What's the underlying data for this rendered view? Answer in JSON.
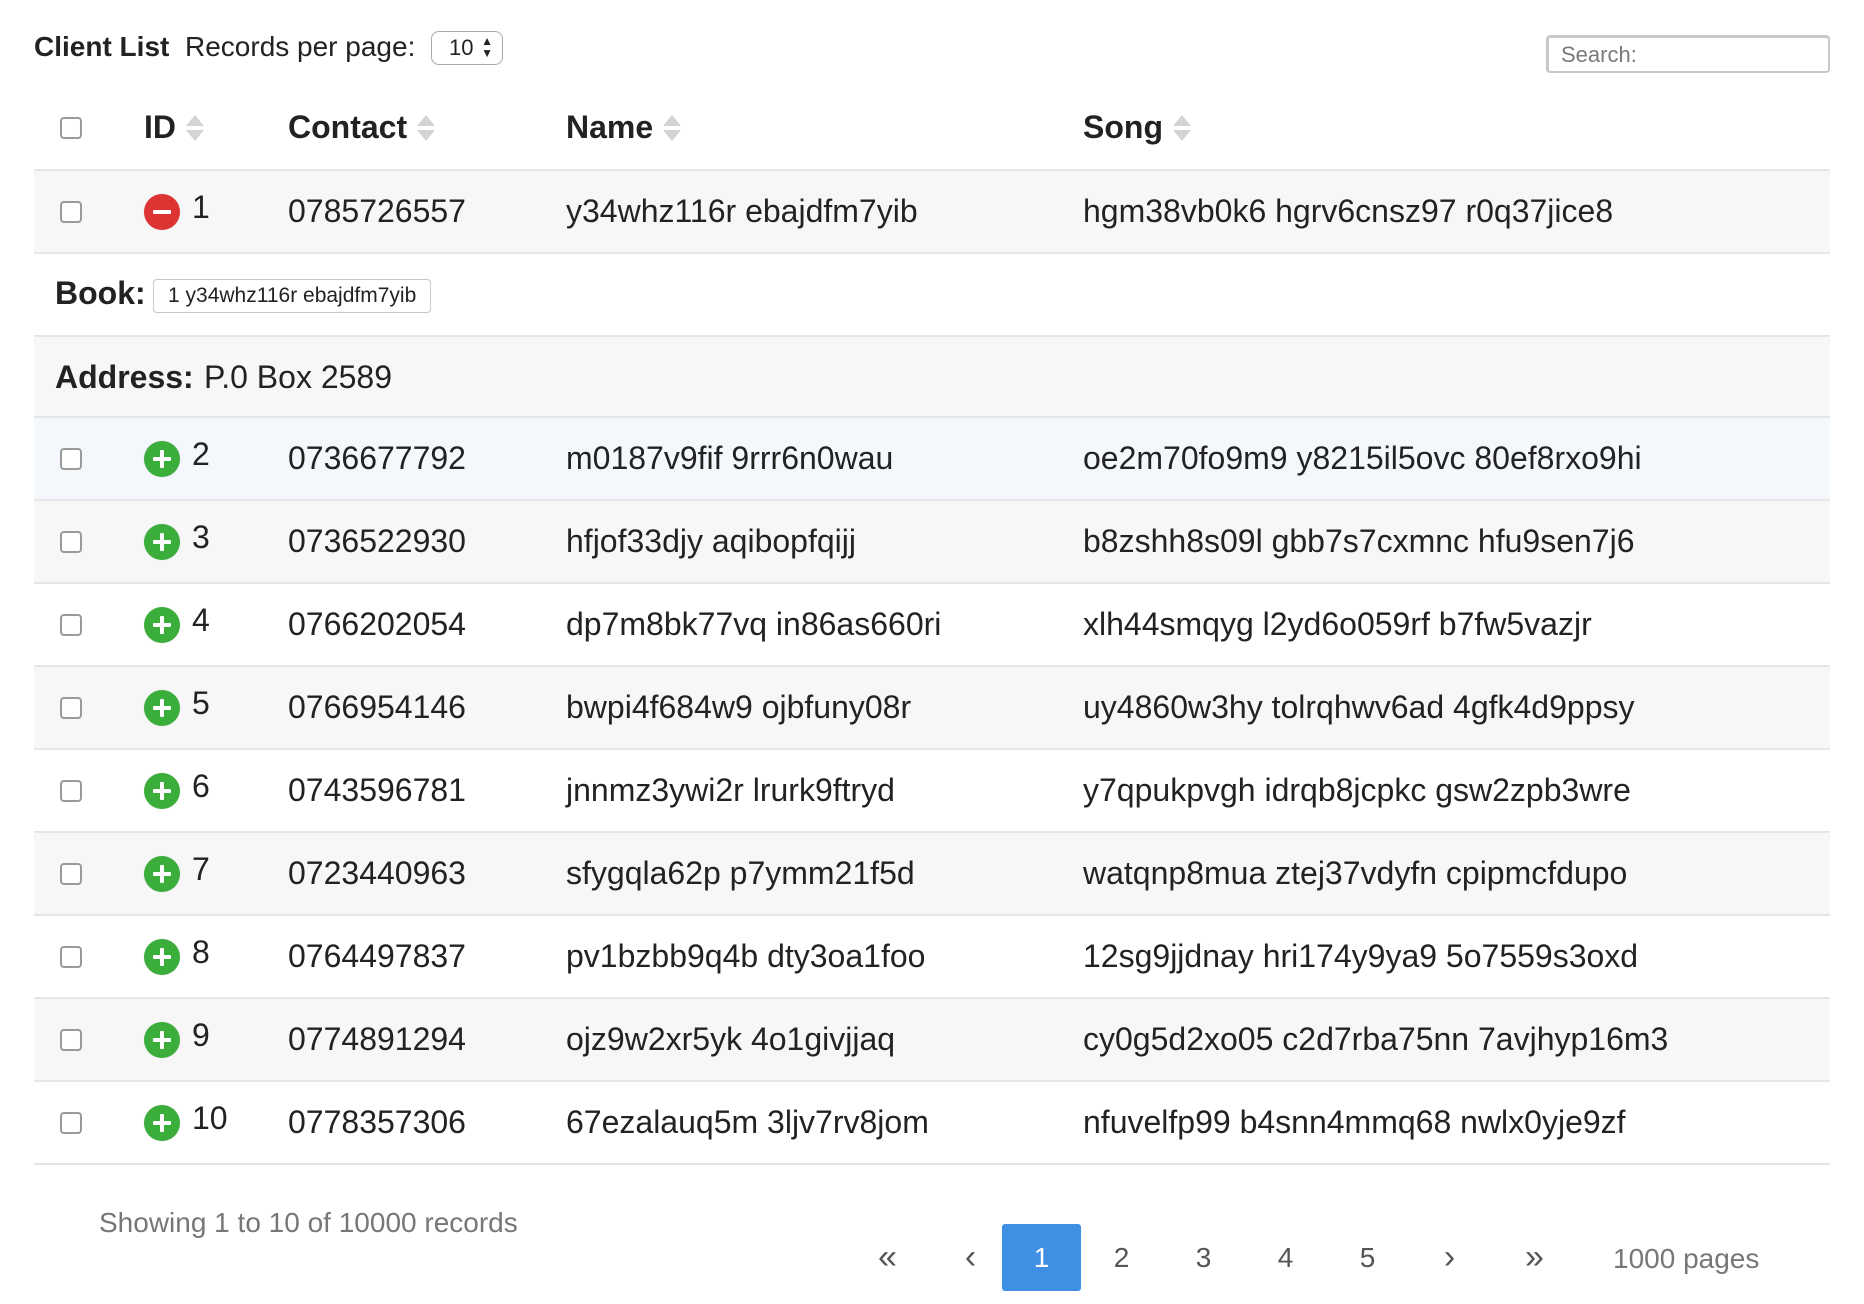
{
  "header": {
    "title": "Client List",
    "records_per_page_label": "Records per page:",
    "records_per_page_value": "10",
    "search_placeholder": "Search:"
  },
  "table": {
    "columns": [
      "ID",
      "Contact",
      "Name",
      "Song"
    ],
    "rows": [
      {
        "id": "1",
        "contact": "0785726557",
        "name": "y34whz116r ebajdfm7yib",
        "song": "hgm38vb0k6 hgrv6cnsz97 r0q37jice8",
        "expanded": true
      },
      {
        "id": "2",
        "contact": "0736677792",
        "name": "m0187v9fif 9rrr6n0wau",
        "song": "oe2m70fo9m9 y8215il5ovc 80ef8rxo9hi",
        "expanded": false
      },
      {
        "id": "3",
        "contact": "0736522930",
        "name": "hfjof33djy aqibopfqijj",
        "song": "b8zshh8s09l gbb7s7cxmnc hfu9sen7j6",
        "expanded": false
      },
      {
        "id": "4",
        "contact": "0766202054",
        "name": "dp7m8bk77vq in86as660ri",
        "song": "xlh44smqyg l2yd6o059rf b7fw5vazjr",
        "expanded": false
      },
      {
        "id": "5",
        "contact": "0766954146",
        "name": "bwpi4f684w9 ojbfuny08r",
        "song": "uy4860w3hy tolrqhwv6ad 4gfk4d9ppsy",
        "expanded": false
      },
      {
        "id": "6",
        "contact": "0743596781",
        "name": "jnnmz3ywi2r lrurk9ftryd",
        "song": "y7qpukpvgh idrqb8jcpkc gsw2zpb3wre",
        "expanded": false
      },
      {
        "id": "7",
        "contact": "0723440963",
        "name": "sfygqla62p p7ymm21f5d",
        "song": "watqnp8mua ztej37vdyfn cpipmcfdupo",
        "expanded": false
      },
      {
        "id": "8",
        "contact": "0764497837",
        "name": "pv1bzbb9q4b dty3oa1foo",
        "song": "12sg9jjdnay hri174y9ya9 5o7559s3oxd",
        "expanded": false
      },
      {
        "id": "9",
        "contact": "0774891294",
        "name": "ojz9w2xr5yk 4o1givjjaq",
        "song": "cy0g5d2xo05 c2d7rba75nn 7avjhyp16m3",
        "expanded": false
      },
      {
        "id": "10",
        "contact": "0778357306",
        "name": "67ezalauq5m 3ljv7rv8jom",
        "song": "nfuvelfp99 b4snn4mmq68 nwlx0yje9zf",
        "expanded": false
      }
    ],
    "detail": {
      "book_label": "Book:",
      "book_value": "1 y34whz116r ebajdfm7yib",
      "address_label": "Address:",
      "address_value": "P.0 Box 2589"
    }
  },
  "footer": {
    "showing_text": "Showing 1 to 10 of 10000 records",
    "pagination": {
      "first": "«",
      "prev": "‹",
      "pages": [
        "1",
        "2",
        "3",
        "4",
        "5"
      ],
      "active_page": "1",
      "next": "›",
      "last": "»",
      "total_pages_text": "1000 pages"
    }
  },
  "colors": {
    "add_control": "#3aad3a",
    "remove_control": "#dd3333",
    "active_page": "#3f8fe4",
    "striped_row": "#f7f7f7"
  }
}
